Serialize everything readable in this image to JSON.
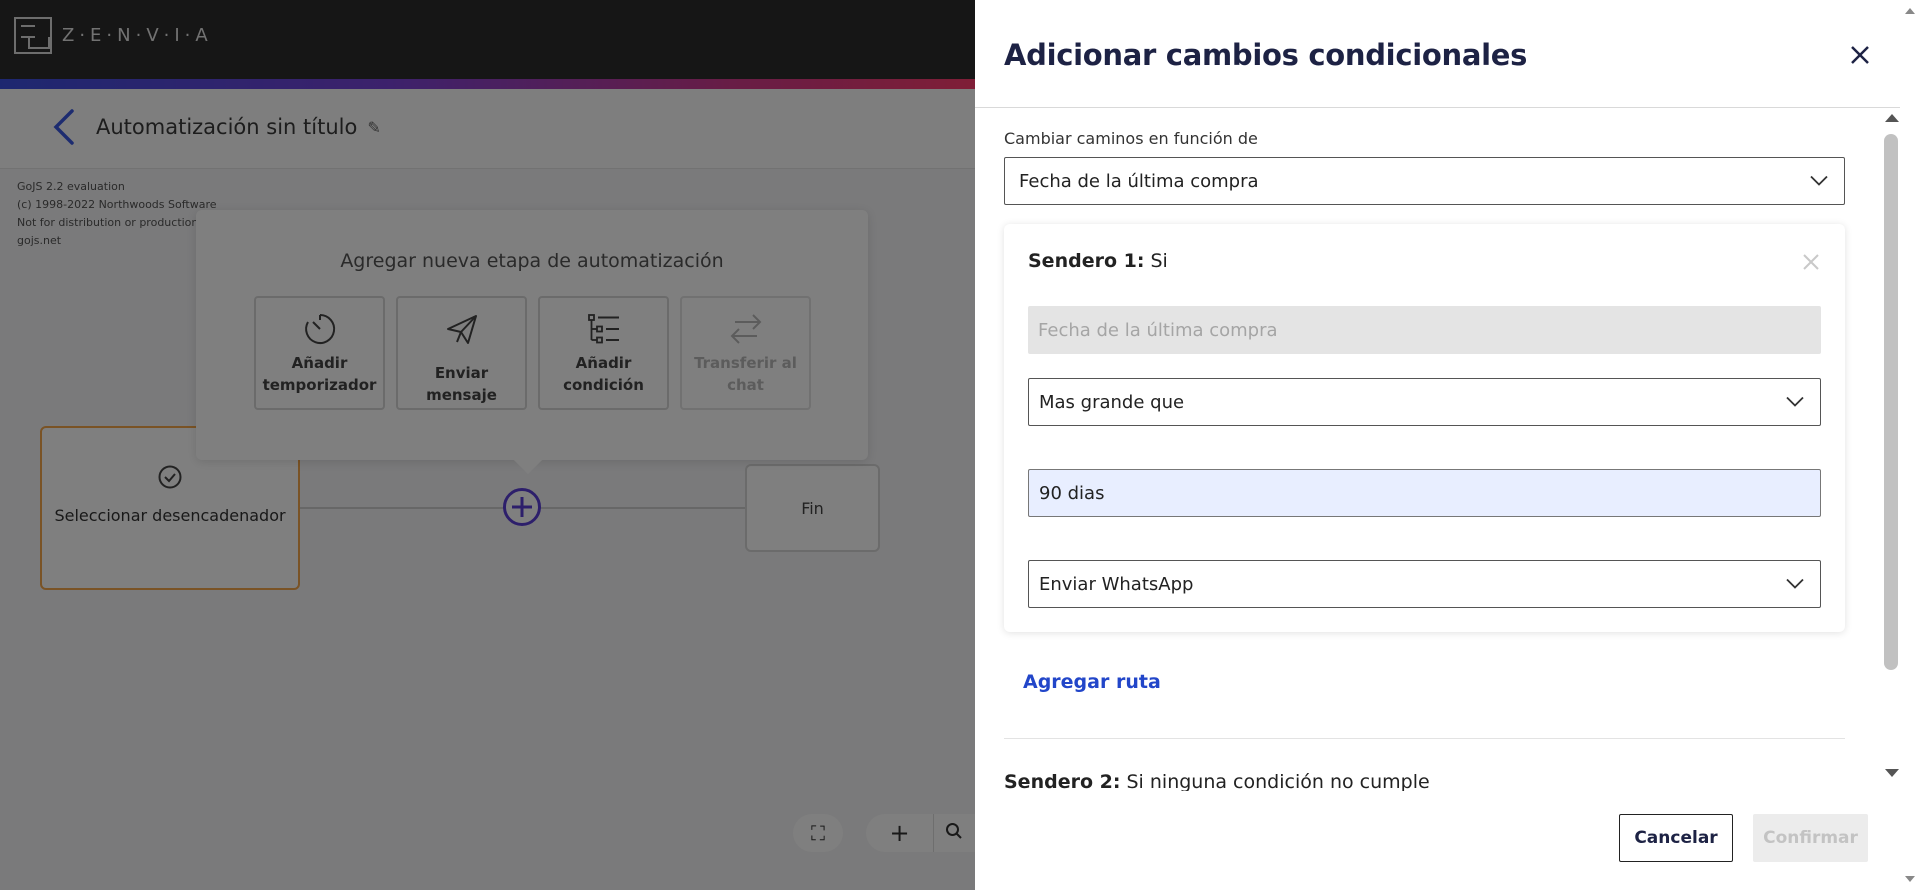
{
  "brand": {
    "name": "Z·E·N·V·I·A"
  },
  "header": {
    "title": "Automatización sin título"
  },
  "gojs_notice": [
    "GoJS 2.2 evaluation",
    "(c) 1998-2022 Northwoods Software",
    "Not for distribution or production u",
    "gojs.net"
  ],
  "popup": {
    "title": "Agregar nueva etapa de automatización",
    "options": [
      {
        "label_line1": "Añadir",
        "label_line2": "temporizador",
        "icon": "timer-icon",
        "enabled": true
      },
      {
        "label_line1": "Enviar mensaje",
        "label_line2": "",
        "icon": "send-icon",
        "enabled": true
      },
      {
        "label_line1": "Añadir",
        "label_line2": "condición",
        "icon": "condition-icon",
        "enabled": true
      },
      {
        "label_line1": "Transferir al",
        "label_line2": "chat",
        "icon": "transfer-icon",
        "enabled": false
      }
    ]
  },
  "flow": {
    "trigger_label": "Seleccionar desencadenador",
    "end_label": "Fin"
  },
  "drawer": {
    "title": "Adicionar cambios condicionales",
    "field_label": "Cambiar caminos en función de",
    "field_value": "Fecha de la última compra",
    "path1": {
      "title_bold": "Sendero 1:",
      "title_rest": " Si",
      "disabled_value": "Fecha de la última compra",
      "operator": "Mas grande que",
      "value": "90 dias",
      "action": "Enviar WhatsApp"
    },
    "add_route": "Agregar ruta",
    "path2": {
      "title_bold": "Sendero 2:",
      "title_rest": " Si ninguna condición no cumple"
    },
    "cancel": "Cancelar",
    "confirm": "Confirmar"
  },
  "colors": {
    "accent": "#2246c9",
    "trigger_border": "#f4a64a",
    "plus": "#5b3fd6",
    "title": "#1d2244"
  }
}
